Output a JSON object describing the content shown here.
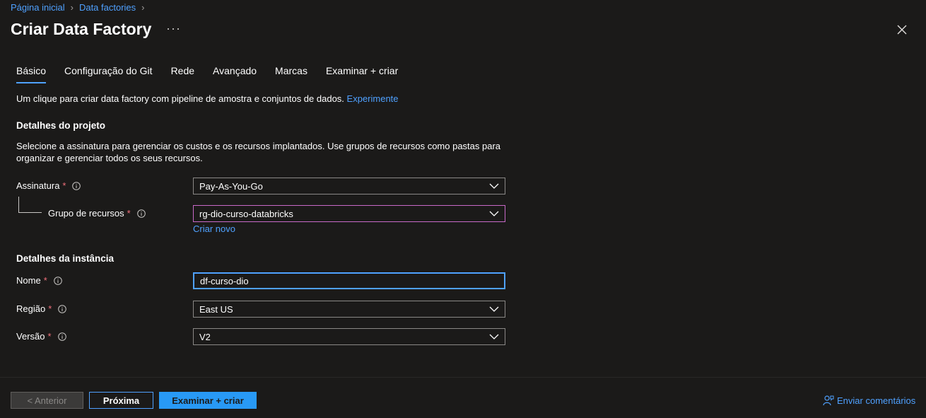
{
  "breadcrumb": {
    "home": "Página inicial",
    "parent": "Data factories"
  },
  "header": {
    "title": "Criar Data Factory",
    "more": "···"
  },
  "tabs": [
    {
      "label": "Básico",
      "active": true
    },
    {
      "label": "Configuração do Git"
    },
    {
      "label": "Rede"
    },
    {
      "label": "Avançado"
    },
    {
      "label": "Marcas"
    },
    {
      "label": "Examinar + criar"
    }
  ],
  "intro": {
    "text": "Um clique para criar data factory com pipeline de amostra e conjuntos de dados.",
    "link": "Experimente"
  },
  "project": {
    "heading": "Detalhes do projeto",
    "description": "Selecione a assinatura para gerenciar os custos e os recursos implantados. Use grupos de recursos como pastas para organizar e gerenciar todos os seus recursos.",
    "subscription_label": "Assinatura",
    "subscription_value": "Pay-As-You-Go",
    "resource_group_label": "Grupo de recursos",
    "resource_group_value": "rg-dio-curso-databricks",
    "create_new": "Criar novo"
  },
  "instance": {
    "heading": "Detalhes da instância",
    "name_label": "Nome",
    "name_value": "df-curso-dio",
    "region_label": "Região",
    "region_value": "East US",
    "version_label": "Versão",
    "version_value": "V2"
  },
  "required_mark": "*",
  "footer": {
    "prev": "< Anterior",
    "next": "Próxima",
    "review": "Examinar + criar",
    "feedback": "Enviar comentários"
  },
  "colors": {
    "accent": "#4fa1ff",
    "primary_button": "#2899f5",
    "required": "#f1707b",
    "background": "#1b1a19"
  }
}
